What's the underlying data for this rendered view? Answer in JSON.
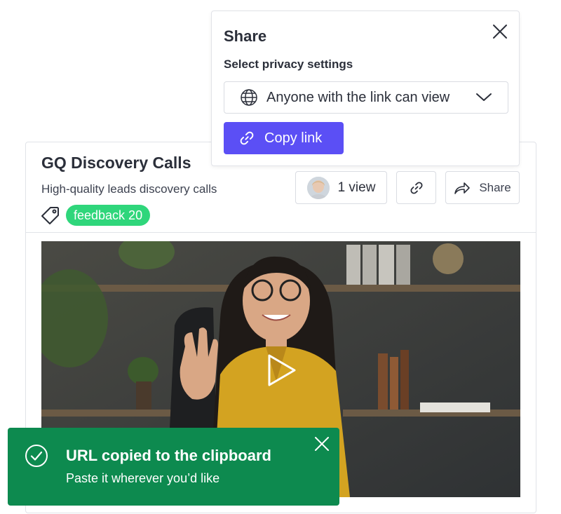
{
  "popover": {
    "title": "Share",
    "privacy_label": "Select privacy settings",
    "privacy_value": "Anyone with the link can view",
    "copy_label": "Copy link"
  },
  "card": {
    "title": "GQ Discovery Calls",
    "subtitle": "High-quality leads discovery calls",
    "tag": "feedback 20",
    "views_label": "1 view",
    "share_label": "Share"
  },
  "toast": {
    "title": "URL copied to the clipboard",
    "message": "Paste it wherever you’d like"
  },
  "colors": {
    "accent": "#5b4ff5",
    "tag_green": "#2fd67b",
    "toast_green": "#0d8a4f"
  }
}
